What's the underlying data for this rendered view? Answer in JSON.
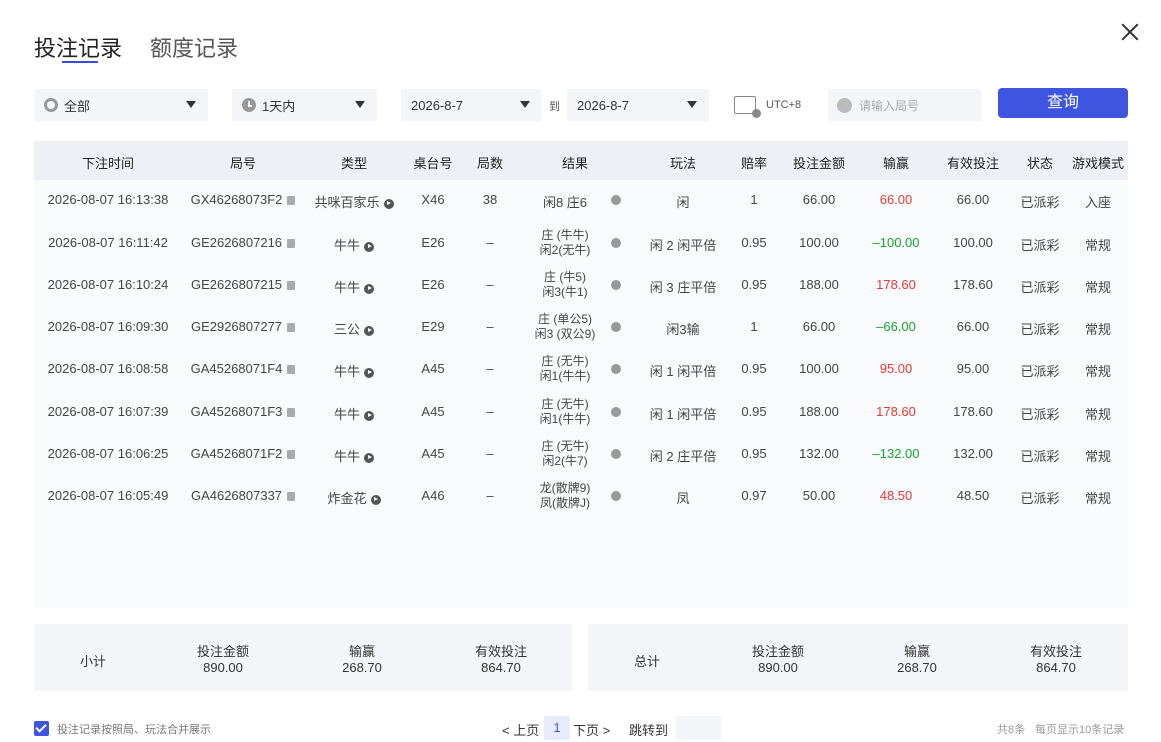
{
  "tabs": [
    "投注记录",
    "额度记录"
  ],
  "filters": {
    "game": "全部",
    "period": "1天内",
    "date_from": "2026-8-7",
    "to_label": "到",
    "date_to": "2026-8-7",
    "timezone": "UTC+8",
    "search_placeholder": "请输入局号",
    "query_label": "查询"
  },
  "table": {
    "headers": [
      "下注时间",
      "局号",
      "类型",
      "桌台号",
      "局数",
      "结果",
      "玩法",
      "赔率",
      "投注金额",
      "输赢",
      "有效投注",
      "状态",
      "游戏模式"
    ],
    "rows": [
      {
        "time": "2026-08-07 16:13:38",
        "round": "GX46268073F2",
        "type": "共咪百家乐",
        "table": "X46",
        "shoe": "38",
        "result1": "闲8 庄6",
        "result2": "",
        "play": "闲",
        "odds": "1",
        "bet": "66.00",
        "win": "66.00",
        "win_color": "red",
        "valid": "66.00",
        "status": "已派彩",
        "mode": "入座"
      },
      {
        "time": "2026-08-07 16:11:42",
        "round": "GE2626807216",
        "type": "牛牛",
        "table": "E26",
        "shoe": "–",
        "result1": "庄 (牛牛)",
        "result2": "闲2(无牛)",
        "play": "闲 2 闲平倍",
        "odds": "0.95",
        "bet": "100.00",
        "win": "–100.00",
        "win_color": "green",
        "valid": "100.00",
        "status": "已派彩",
        "mode": "常规"
      },
      {
        "time": "2026-08-07 16:10:24",
        "round": "GE2626807215",
        "type": "牛牛",
        "table": "E26",
        "shoe": "–",
        "result1": "庄 (牛5)",
        "result2": "闲3(牛1)",
        "play": "闲 3 庄平倍",
        "odds": "0.95",
        "bet": "188.00",
        "win": "178.60",
        "win_color": "red",
        "valid": "178.60",
        "status": "已派彩",
        "mode": "常规"
      },
      {
        "time": "2026-08-07 16:09:30",
        "round": "GE2926807277",
        "type": "三公",
        "table": "E29",
        "shoe": "–",
        "result1": "庄 (单公5)",
        "result2": "闲3 (双公9)",
        "play": "闲3输",
        "odds": "1",
        "bet": "66.00",
        "win": "–66.00",
        "win_color": "green",
        "valid": "66.00",
        "status": "已派彩",
        "mode": "常规"
      },
      {
        "time": "2026-08-07 16:08:58",
        "round": "GA45268071F4",
        "type": "牛牛",
        "table": "A45",
        "shoe": "–",
        "result1": "庄 (无牛)",
        "result2": "闲1(牛牛)",
        "play": "闲 1 闲平倍",
        "odds": "0.95",
        "bet": "100.00",
        "win": "95.00",
        "win_color": "red",
        "valid": "95.00",
        "status": "已派彩",
        "mode": "常规"
      },
      {
        "time": "2026-08-07 16:07:39",
        "round": "GA45268071F3",
        "type": "牛牛",
        "table": "A45",
        "shoe": "–",
        "result1": "庄 (无牛)",
        "result2": "闲1(牛牛)",
        "play": "闲 1 闲平倍",
        "odds": "0.95",
        "bet": "188.00",
        "win": "178.60",
        "win_color": "red",
        "valid": "178.60",
        "status": "已派彩",
        "mode": "常规"
      },
      {
        "time": "2026-08-07 16:06:25",
        "round": "GA45268071F2",
        "type": "牛牛",
        "table": "A45",
        "shoe": "–",
        "result1": "庄 (无牛)",
        "result2": "闲2(牛7)",
        "play": "闲 2 庄平倍",
        "odds": "0.95",
        "bet": "132.00",
        "win": "–132.00",
        "win_color": "green",
        "valid": "132.00",
        "status": "已派彩",
        "mode": "常规"
      },
      {
        "time": "2026-08-07 16:05:49",
        "round": "GA4626807337",
        "type": "炸金花",
        "table": "A46",
        "shoe": "–",
        "result1": "龙(散牌9)",
        "result2": "凤(散牌J)",
        "play": "凤",
        "odds": "0.97",
        "bet": "50.00",
        "win": "48.50",
        "win_color": "red",
        "valid": "48.50",
        "status": "已派彩",
        "mode": "常规"
      }
    ]
  },
  "subtotal": {
    "label": "小计",
    "bet_label": "投注金额",
    "bet": "890.00",
    "win_label": "输赢",
    "win": "268.70",
    "valid_label": "有效投注",
    "valid": "864.70"
  },
  "total": {
    "label": "总计",
    "bet_label": "投注金额",
    "bet": "890.00",
    "win_label": "输赢",
    "win": "268.70",
    "valid_label": "有效投注",
    "valid": "864.70"
  },
  "footer": {
    "merge_label": "投注记录按照局、玩法合并展示",
    "prev": "< 上页",
    "page": "1",
    "next": "下页 >",
    "jump": "跳转到",
    "count": "共8条",
    "per_page": "每页显示10条记录"
  },
  "colors": {
    "accent": "#3e55e0",
    "win": "#e53935",
    "loss": "#13a531"
  }
}
